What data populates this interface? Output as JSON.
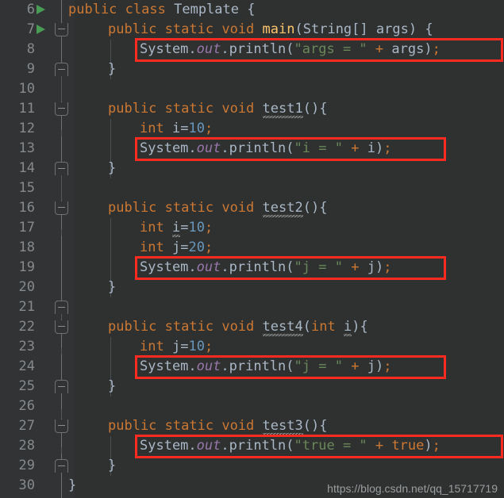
{
  "editor": {
    "theme": "darcula",
    "background_color": "#2f3131",
    "gutter_color": "#313335",
    "first_line_number": 6,
    "last_line_number": 30,
    "line_height_px": 25,
    "colors": {
      "keyword": "#cc7832",
      "string": "#6a8759",
      "number": "#6897bb",
      "field": "#9876aa",
      "method": "#ffc66d",
      "default_text": "#a9b7c6",
      "line_number": "#868a8c",
      "highlight_box": "#ff2b21",
      "run_marker": "#499c54"
    }
  },
  "lines": [
    {
      "num": "6",
      "text": "public class Template {"
    },
    {
      "num": "7",
      "text": "    public static void main(String[] args) {"
    },
    {
      "num": "8",
      "text": "        System.out.println(\"args = \" + args);"
    },
    {
      "num": "9",
      "text": "    }"
    },
    {
      "num": "10",
      "text": ""
    },
    {
      "num": "11",
      "text": "    public static void test1(){"
    },
    {
      "num": "12",
      "text": "        int i=10;"
    },
    {
      "num": "13",
      "text": "        System.out.println(\"i = \" + i);"
    },
    {
      "num": "14",
      "text": "    }"
    },
    {
      "num": "15",
      "text": ""
    },
    {
      "num": "16",
      "text": "    public static void test2(){"
    },
    {
      "num": "17",
      "text": "        int i=10;"
    },
    {
      "num": "18",
      "text": "        int j=20;"
    },
    {
      "num": "19",
      "text": "        System.out.println(\"j = \" + j);"
    },
    {
      "num": "20",
      "text": "    }"
    },
    {
      "num": "21",
      "text": ""
    },
    {
      "num": "22",
      "text": "    public static void test4(int i){"
    },
    {
      "num": "23",
      "text": "        int j=10;"
    },
    {
      "num": "24",
      "text": "        System.out.println(\"j = \" + j);"
    },
    {
      "num": "25",
      "text": "    }"
    },
    {
      "num": "26",
      "text": ""
    },
    {
      "num": "27",
      "text": "    public static void test3(){"
    },
    {
      "num": "28",
      "text": "        System.out.println(\"true = \" + true);"
    },
    {
      "num": "29",
      "text": "    }"
    },
    {
      "num": "30",
      "text": "}"
    }
  ],
  "tokens": {
    "l6": {
      "kw": "public",
      "kw2": "class",
      "cls": "Template",
      "brace": "{"
    },
    "l7": {
      "kw": "public",
      "kw2": "static",
      "kw3": "void",
      "method": "main",
      "type": "String",
      "param": "args",
      "brace": "{"
    },
    "l8": {
      "obj": "System",
      "field": "out",
      "call": "println",
      "string": "\"args = \"",
      "plus": "+",
      "arg": "args"
    },
    "l11": {
      "kw": "public",
      "kw2": "static",
      "kw3": "void",
      "method": "test1"
    },
    "l12": {
      "kw": "int",
      "var": "i",
      "value": "10"
    },
    "l13": {
      "obj": "System",
      "field": "out",
      "call": "println",
      "string": "\"i = \"",
      "plus": "+",
      "arg": "i"
    },
    "l16": {
      "kw": "public",
      "kw2": "static",
      "kw3": "void",
      "method": "test2"
    },
    "l17": {
      "kw": "int",
      "var": "i",
      "value": "10"
    },
    "l18": {
      "kw": "int",
      "var": "j",
      "value": "20"
    },
    "l19": {
      "obj": "System",
      "field": "out",
      "call": "println",
      "string": "\"j = \"",
      "plus": "+",
      "arg": "j"
    },
    "l22": {
      "kw": "public",
      "kw2": "static",
      "kw3": "void",
      "method": "test4",
      "ptype": "int",
      "pname": "i"
    },
    "l23": {
      "kw": "int",
      "var": "j",
      "value": "10"
    },
    "l24": {
      "obj": "System",
      "field": "out",
      "call": "println",
      "string": "\"j = \"",
      "plus": "+",
      "arg": "j"
    },
    "l27": {
      "kw": "public",
      "kw2": "static",
      "kw3": "void",
      "method": "test3"
    },
    "l28": {
      "obj": "System",
      "field": "out",
      "call": "println",
      "string": "\"true = \"",
      "plus": "+",
      "arg": "true"
    }
  },
  "gutter": {
    "run_marker_lines": [
      "6",
      "7"
    ],
    "fold_open_lines": [
      "7",
      "11",
      "16",
      "22",
      "27"
    ],
    "fold_close_lines": [
      "9",
      "14",
      "20",
      "25",
      "29"
    ]
  },
  "highlights": [
    {
      "line": "8",
      "label": "println-args"
    },
    {
      "line": "13",
      "label": "println-i"
    },
    {
      "line": "19",
      "label": "println-j-test2"
    },
    {
      "line": "24",
      "label": "println-j-test4"
    },
    {
      "line": "28",
      "label": "println-true"
    }
  ],
  "watermark": {
    "text": "https://blog.csdn.net/qq_15717719"
  }
}
